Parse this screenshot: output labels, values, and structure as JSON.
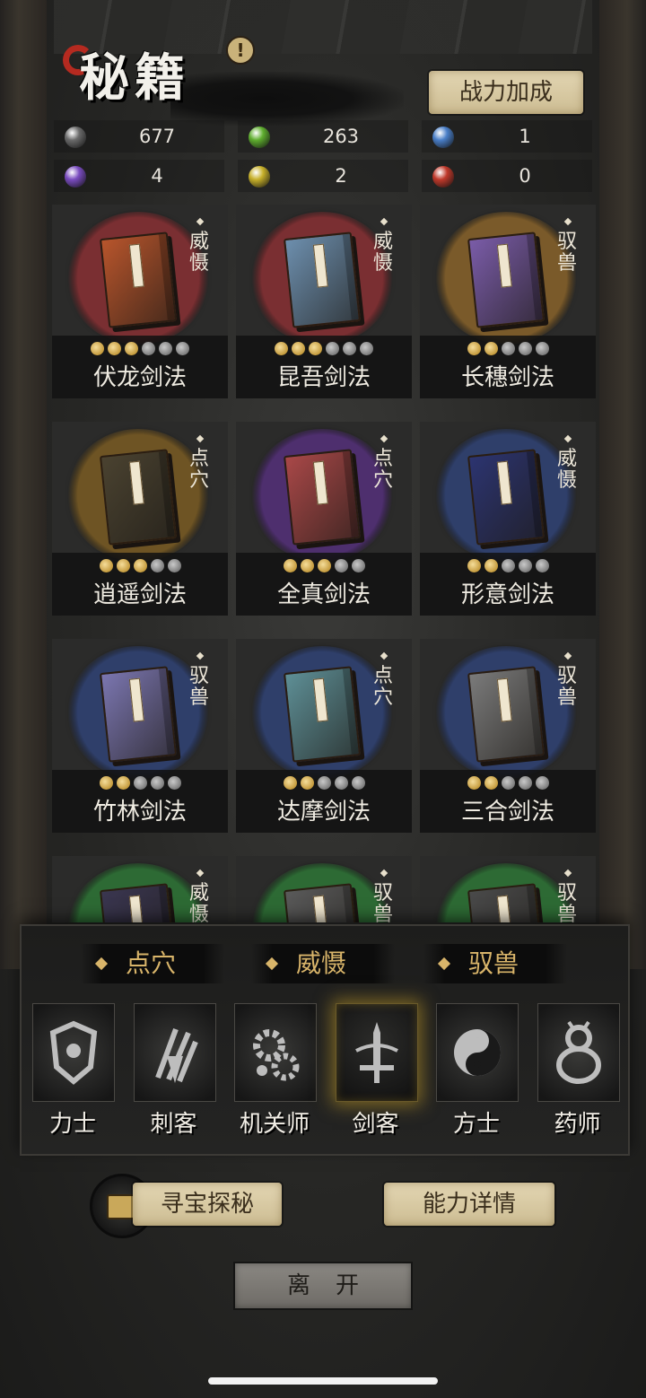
{
  "header": {
    "title": "秘籍",
    "badge": "!",
    "power_button": "战力加成"
  },
  "resources": [
    {
      "color": "#6b6b6b",
      "value": "677"
    },
    {
      "color": "#5fae2f",
      "value": "263"
    },
    {
      "color": "#4a7fc8",
      "value": "1"
    },
    {
      "color": "#7a4cc0",
      "value": "4"
    },
    {
      "color": "#c7b02a",
      "value": "2"
    },
    {
      "color": "#c0392b",
      "value": "0"
    }
  ],
  "books": [
    {
      "name": "伏龙剑法",
      "type": "威慑",
      "stars": 3,
      "max": 6,
      "circle": "#7a2f32",
      "cover": "#b8552c"
    },
    {
      "name": "昆吾剑法",
      "type": "威慑",
      "stars": 3,
      "max": 6,
      "circle": "#7a2f32",
      "cover": "#6d8fae"
    },
    {
      "name": "长穗剑法",
      "type": "驭兽",
      "stars": 2,
      "max": 5,
      "circle": "#7a5a2a",
      "cover": "#7a5ca8"
    },
    {
      "name": "逍遥剑法",
      "type": "点穴",
      "stars": 3,
      "max": 5,
      "circle": "#6e5424",
      "cover": "#4a4230"
    },
    {
      "name": "全真剑法",
      "type": "点穴",
      "stars": 3,
      "max": 5,
      "circle": "#4e2f6e",
      "cover": "#a94848"
    },
    {
      "name": "形意剑法",
      "type": "威慑",
      "stars": 2,
      "max": 5,
      "circle": "#2f3f6a",
      "cover": "#2c3470"
    },
    {
      "name": "竹林剑法",
      "type": "驭兽",
      "stars": 2,
      "max": 5,
      "circle": "#2f3f6a",
      "cover": "#7b76b0"
    },
    {
      "name": "达摩剑法",
      "type": "点穴",
      "stars": 2,
      "max": 5,
      "circle": "#2f3f6a",
      "cover": "#5e8f96"
    },
    {
      "name": "三合剑法",
      "type": "驭兽",
      "stars": 2,
      "max": 5,
      "circle": "#2f3f6a",
      "cover": "#7a7a7a"
    },
    {
      "name": "",
      "type": "威慑",
      "stars": 0,
      "max": 0,
      "circle": "#2d6a34",
      "cover": "#3a3650"
    },
    {
      "name": "",
      "type": "驭兽",
      "stars": 0,
      "max": 0,
      "circle": "#2d6a34",
      "cover": "#5a5a5a"
    },
    {
      "name": "",
      "type": "驭兽",
      "stars": 0,
      "max": 0,
      "circle": "#2d6a34",
      "cover": "#4a4a4a"
    }
  ],
  "filters": [
    "点穴",
    "威慑",
    "驭兽"
  ],
  "classes": [
    {
      "label": "力士",
      "icon": "shield-icon",
      "selected": false
    },
    {
      "label": "刺客",
      "icon": "claw-icon",
      "selected": false
    },
    {
      "label": "机关师",
      "icon": "gears-icon",
      "selected": false
    },
    {
      "label": "剑客",
      "icon": "sword-icon",
      "selected": true
    },
    {
      "label": "方士",
      "icon": "yin-yang-icon",
      "selected": false
    },
    {
      "label": "药师",
      "icon": "gourd-icon",
      "selected": false
    }
  ],
  "actions": {
    "treasure": "寻宝探秘",
    "details": "能力详情",
    "leave": "离开"
  },
  "colors": {
    "gold": "#d9b56a",
    "paper": "#e3d6b3",
    "selected_glow": "#c8a028"
  }
}
